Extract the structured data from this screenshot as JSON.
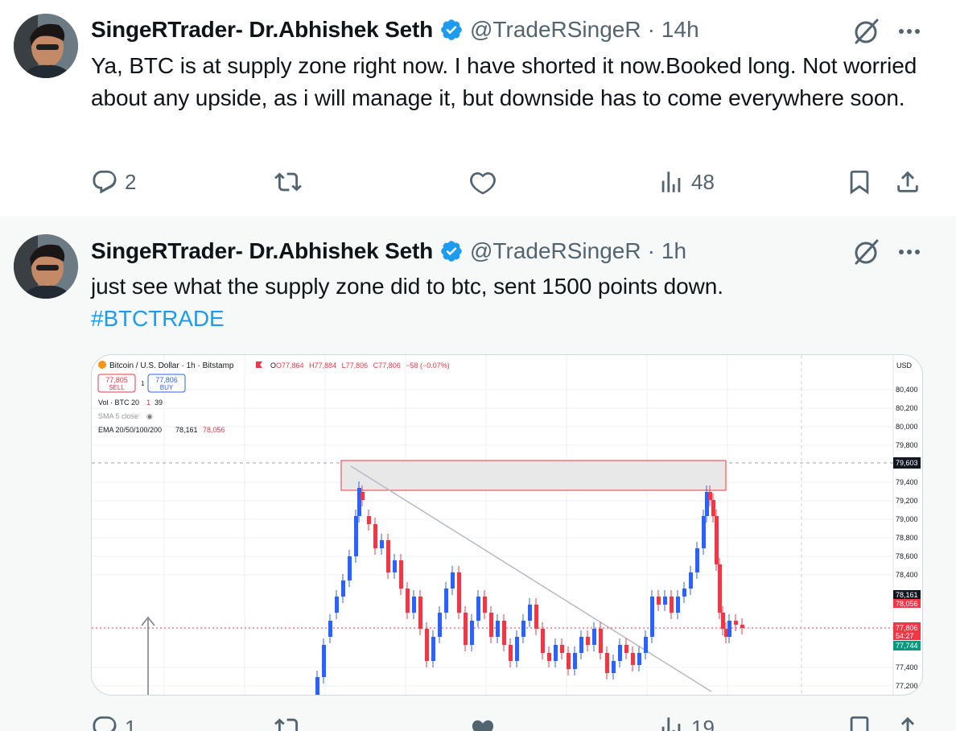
{
  "tweets": [
    {
      "author": "SingeRTrader- Dr.Abhishek Seth",
      "handle": "@TradeRSingeR",
      "separator": "·",
      "time": "14h",
      "text": "Ya, BTC is at supply zone right now. I have shorted it now.Booked long. Not worried about any upside, as i will manage it, but downside has to come everywhere soon.",
      "replies": "2",
      "views": "48"
    },
    {
      "author": "SingeRTrader- Dr.Abhishek Seth",
      "handle": "@TradeRSingeR",
      "separator": "·",
      "time": "1h",
      "text": "just see what the supply zone did to btc, sent 1500 points down.",
      "hashtag": "#BTCTRADE",
      "replies": "1",
      "views": "19"
    }
  ],
  "colors": {
    "accent": "#1d9bf0",
    "muted": "#536471",
    "up": "#2962ff",
    "down": "#f23645"
  },
  "icons": [
    "verified-badge-icon",
    "grok-icon",
    "more-icon",
    "reply-icon",
    "retweet-icon",
    "like-icon",
    "views-icon",
    "bookmark-icon",
    "share-icon"
  ],
  "chart": {
    "header": "Bitcoin / U.S. Dollar · 1h · Bitstamp",
    "ohlc": {
      "open": "O77,864",
      "high": "H77,884",
      "low": "L77,806",
      "close": "C77,806",
      "change": "−58 (−0.07%)"
    },
    "sell_price": "77,805",
    "sell_label": "SELL",
    "spread": "1",
    "buy_price": "77,806",
    "buy_label": "BUY",
    "volume_label": "Vol · BTC 20",
    "volume_value": "1",
    "volume_value2": "39",
    "sma_label": "SMA 5 close",
    "ema_label": "EMA 20/50/100/200",
    "ema_value": "78,161",
    "ema_value2": "78,056",
    "currency": "USD",
    "price_ticks": [
      "80,400",
      "80,200",
      "80,000",
      "79,800",
      "79,400",
      "79,200",
      "79,000",
      "78,800",
      "78,600",
      "78,400",
      "77,400",
      "77,200"
    ],
    "labels": {
      "supply_top": "79,603",
      "ema_a": "78,161",
      "ema_b": "78,056",
      "last": "77,806",
      "countdown": "54:27",
      "bid": "77,744"
    }
  }
}
